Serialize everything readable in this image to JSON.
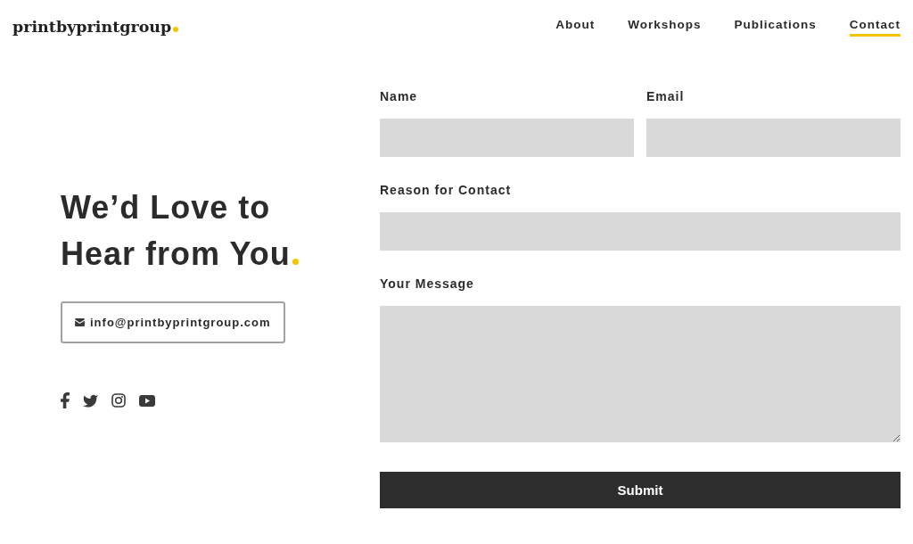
{
  "header": {
    "logo": "printbyprintgroup",
    "nav": [
      {
        "label": "About",
        "selected": false
      },
      {
        "label": "Workshops",
        "selected": false
      },
      {
        "label": "Publications",
        "selected": false
      },
      {
        "label": "Contact",
        "selected": true
      }
    ]
  },
  "intro": {
    "heading": "We’d Love to Hear from You",
    "email": "info@printbyprintgroup.com"
  },
  "form": {
    "rows": [
      {
        "fields": [
          {
            "label": "Name",
            "kind": "input"
          },
          {
            "label": "Email",
            "kind": "input"
          }
        ]
      },
      {
        "fields": [
          {
            "label": "Reason for Contact",
            "kind": "input"
          }
        ]
      },
      {
        "fields": [
          {
            "label": "Your Message",
            "kind": "textarea"
          }
        ]
      }
    ],
    "submit": "Submit"
  }
}
